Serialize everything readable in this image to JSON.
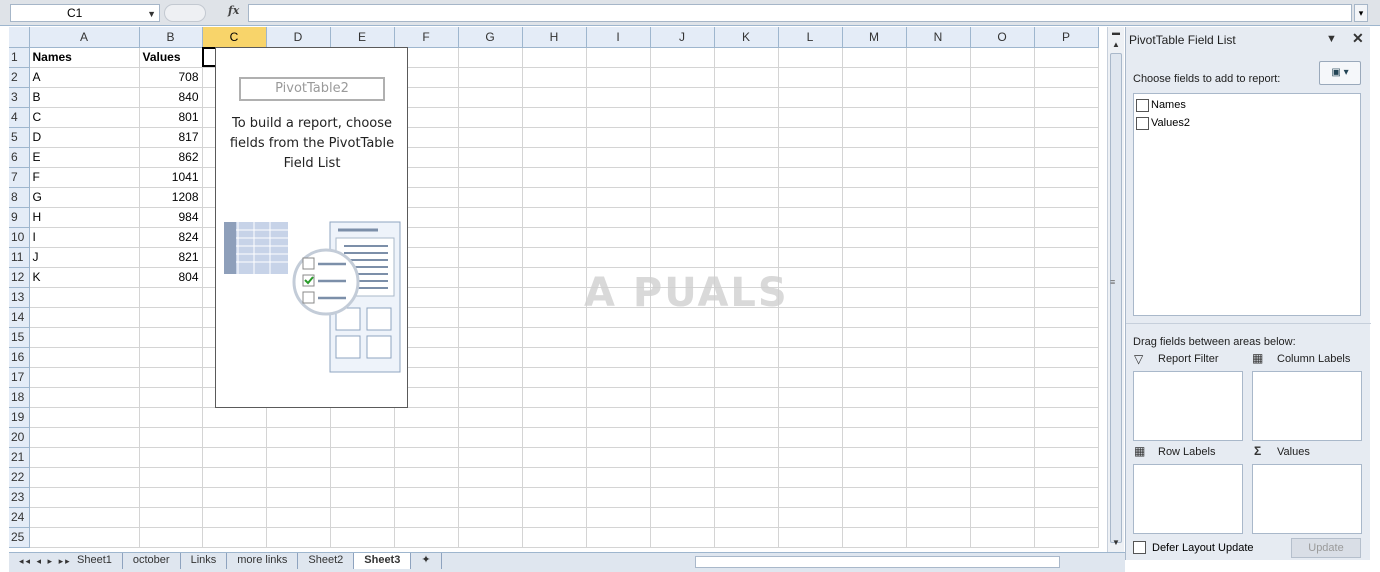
{
  "formula_bar": {
    "name_box": "C1",
    "fx": "fx",
    "formula": ""
  },
  "columns": [
    "A",
    "B",
    "C",
    "D",
    "E",
    "F",
    "G",
    "H",
    "I",
    "J",
    "K",
    "L",
    "M",
    "N",
    "O",
    "P"
  ],
  "selected_column": "C",
  "row_numbers": [
    "1",
    "2",
    "3",
    "4",
    "5",
    "6",
    "7",
    "8",
    "9",
    "10",
    "11",
    "12",
    "13",
    "14",
    "15",
    "16",
    "17",
    "18",
    "19",
    "20",
    "21",
    "22",
    "23",
    "24",
    "25"
  ],
  "cells": {
    "A": [
      "Names",
      "A",
      "B",
      "C",
      "D",
      "E",
      "F",
      "G",
      "H",
      "I",
      "J",
      "K"
    ],
    "B": [
      "Values",
      "708",
      "840",
      "801",
      "817",
      "862",
      "1041",
      "1208",
      "984",
      "824",
      "821",
      "804"
    ]
  },
  "pivot": {
    "name": "PivotTable2",
    "message": "To build a report, choose fields from the PivotTable Field List"
  },
  "watermark": "A PUALS",
  "sheet_tabs": [
    "Sheet1",
    "october",
    "Links",
    "more links",
    "Sheet2",
    "Sheet3"
  ],
  "active_tab": "Sheet3",
  "field_panel": {
    "title": "PivotTable Field List",
    "choose_label": "Choose fields to add to report:",
    "fields": [
      "Names",
      "Values2"
    ],
    "drag_label": "Drag fields between areas below:",
    "areas": {
      "report_filter": "Report Filter",
      "column_labels": "Column Labels",
      "row_labels": "Row Labels",
      "values": "Values"
    },
    "defer_label": "Defer Layout Update",
    "update_label": "Update"
  }
}
